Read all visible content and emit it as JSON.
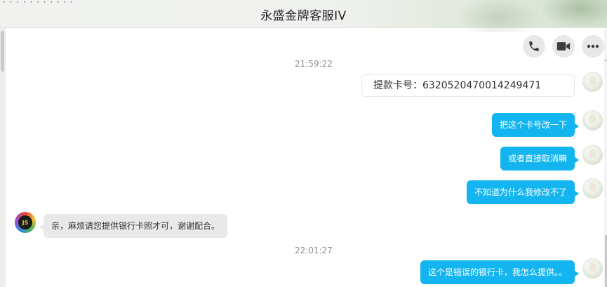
{
  "window": {
    "title": "永盛金牌客服IV",
    "top_dots": "· · · · · · · · · · ·"
  },
  "toolbar": {
    "voice_call_icon": "phone-icon",
    "video_call_icon": "video-camera-icon",
    "more_icon": "more-dots-icon",
    "corner_mark": "ᵔ"
  },
  "colors": {
    "outgoing_bubble": "#13b5f0",
    "incoming_bubble": "#e9e9e9",
    "timestamp": "#8f8f8f"
  },
  "messages": [
    {
      "type": "time",
      "text": "21:59:22"
    },
    {
      "type": "card",
      "sender": "user",
      "text": "提款卡号：6320520470014249471"
    },
    {
      "type": "out",
      "sender": "user",
      "text": "把这个卡号改一下"
    },
    {
      "type": "out",
      "sender": "user",
      "text": "或者直接取消嘛"
    },
    {
      "type": "out",
      "sender": "user",
      "text": "不知道为什么我修改不了"
    },
    {
      "type": "in",
      "sender": "agent",
      "text": "亲，麻烦请您提供银行卡照才可，谢谢配合。"
    },
    {
      "type": "time",
      "text": "22:01:27"
    },
    {
      "type": "out",
      "sender": "user",
      "text": "这个是错误的银行卡，我怎么提供。。"
    }
  ],
  "agent_avatar_text": "JS"
}
